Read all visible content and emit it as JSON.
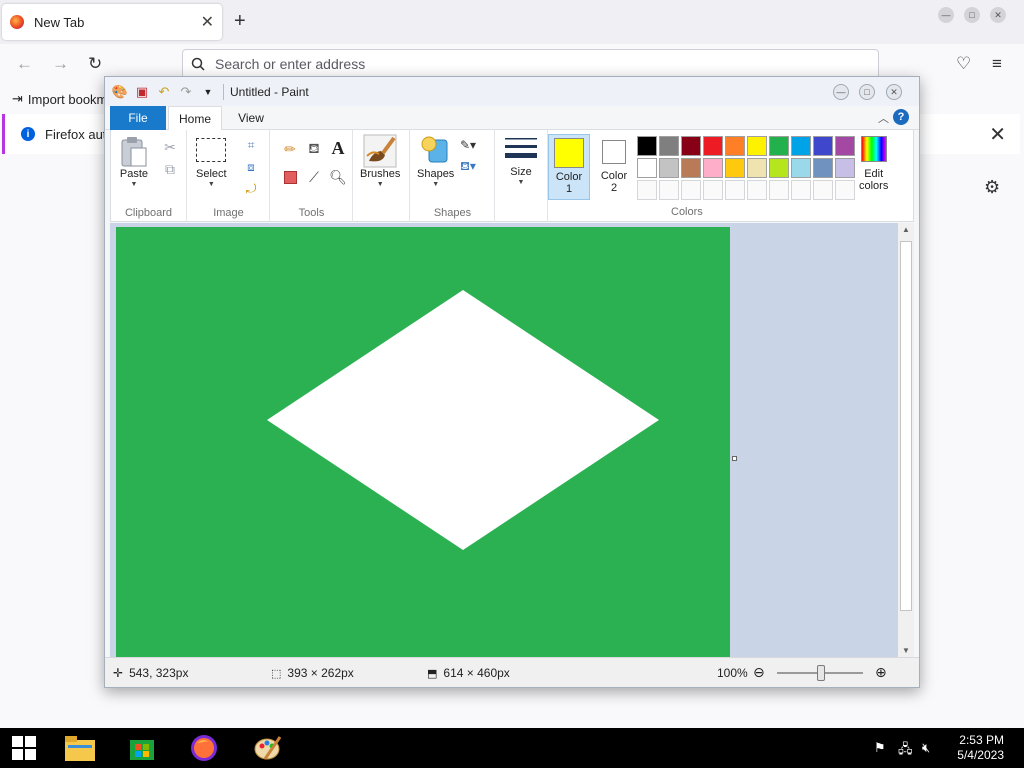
{
  "browser": {
    "tab_title": "New Tab",
    "tab_close": "✕",
    "new_tab": "+",
    "url_placeholder": "Search or enter address",
    "bookmark_label": "Import bookm",
    "notice_text": "Firefox auto",
    "notice_close": "✕"
  },
  "paint": {
    "window_title": "Untitled - Paint",
    "tabs": {
      "file": "File",
      "home": "Home",
      "view": "View"
    },
    "help": "?",
    "groups": {
      "clipboard": "Clipboard",
      "image": "Image",
      "tools": "Tools",
      "shapes": "Shapes",
      "colors": "Colors"
    },
    "buttons": {
      "paste": "Paste",
      "select": "Select",
      "brushes": "Brushes",
      "shapes": "Shapes",
      "size": "Size",
      "color1_line1": "Color",
      "color1_line2": "1",
      "color2_line1": "Color",
      "color2_line2": "2",
      "edit_colors_line1": "Edit",
      "edit_colors_line2": "colors"
    },
    "color1_value": "#ffff00",
    "color2_value": "#ffffff",
    "palette": [
      "#000000",
      "#7f7f7f",
      "#880015",
      "#ed1c24",
      "#ff7f27",
      "#fff200",
      "#22b14c",
      "#00a2e8",
      "#3f48cc",
      "#a349a4",
      "#ffffff",
      "#c3c3c3",
      "#b97a57",
      "#ffaec9",
      "#ffc90e",
      "#efe4b0",
      "#b5e61d",
      "#99d9ea",
      "#7092be",
      "#c8bfe7"
    ],
    "canvas_color": "#2bb152",
    "shape_color": "#ffffff",
    "status": {
      "cursor_pos": "543, 323px",
      "selection_size": "393 × 262px",
      "image_size": "614 × 460px",
      "zoom": "100%"
    }
  },
  "taskbar": {
    "time": "2:53 PM",
    "date": "5/4/2023"
  }
}
